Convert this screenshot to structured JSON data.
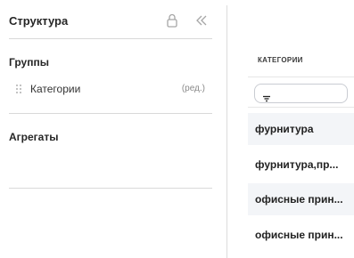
{
  "structure_panel": {
    "title": "Структура",
    "lock_icon": "lock-icon",
    "collapse_icon": "double-chevron-left-icon",
    "groups": {
      "title": "Группы",
      "items": [
        {
          "label": "Категории",
          "edit_label": "(ред.)"
        }
      ]
    },
    "aggregates": {
      "title": "Агрегаты"
    }
  },
  "table": {
    "column_header": "КАТЕГОРИИ",
    "filter_icon": "filter-icon",
    "rows": [
      "фурнитура",
      "фурнитура,пр...",
      "офисные прин...",
      "офисные прин..."
    ]
  }
}
